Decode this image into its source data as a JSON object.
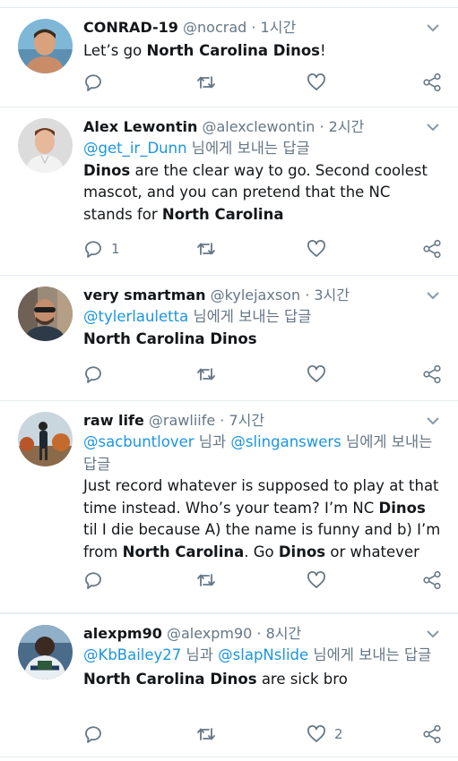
{
  "tweets": [
    {
      "name": "CONRAD-19",
      "handle": "@nocrad",
      "time": "· 1시간",
      "reply_to": null,
      "body_html": "Let’s go <b>North Carolina Dinos</b>!",
      "reply_count": "",
      "like_count": ""
    },
    {
      "name": "Alex Lewontin",
      "handle": "@alexclewontin",
      "time": "· 2시간",
      "reply_to": {
        "mention1": "@get_ir_Dunn",
        "suffix": " 님에게 보내는 답글"
      },
      "body_html": "<b>Dinos</b> are the clear way to go. Second coolest mascot, and you can pretend that the NC stands for <b>North Carolina</b>",
      "reply_count": "1",
      "like_count": ""
    },
    {
      "name": "very smartman",
      "handle": "@kylejaxson",
      "time": "· 3시간",
      "reply_to": {
        "mention1": "@tylerlauletta",
        "suffix": " 님에게 보내는 답글"
      },
      "body_html": "<b>North Carolina Dinos</b>",
      "reply_count": "",
      "like_count": ""
    },
    {
      "name": "raw life",
      "handle": "@rawliife",
      "time": "· 7시간",
      "reply_to": {
        "mention1": "@sacbuntlover",
        "joiner": " 님과 ",
        "mention2": "@slinganswers",
        "suffix": " 님에게 보내는 답글"
      },
      "body_html": "Just record whatever is supposed to play at that time instead. Who’s your team? I’m NC <b>Dinos</b> til I die because A) the name is funny and b) I’m from <b>North Carolina</b>.  Go <b>Dinos</b> or whatever",
      "reply_count": "",
      "like_count": ""
    },
    {
      "name": "alexpm90",
      "handle": "@alexpm90",
      "time": "· 8시간",
      "reply_to": {
        "mention1": "@KbBailey27",
        "joiner": " 님과 ",
        "mention2": "@slapNslide",
        "suffix": " 님에게 보내는 답글"
      },
      "body_html": "<b>North Carolina Dinos</b> are sick bro",
      "reply_count": "",
      "like_count": "2"
    }
  ],
  "icons": {
    "reply": "reply-icon",
    "retweet": "retweet-icon",
    "like": "like-icon",
    "share": "share-icon",
    "more": "chevron-down-icon"
  },
  "colors": {
    "text": "#14171a",
    "muted": "#657786",
    "link": "#1b95e0",
    "divider": "#e6ecf0"
  }
}
